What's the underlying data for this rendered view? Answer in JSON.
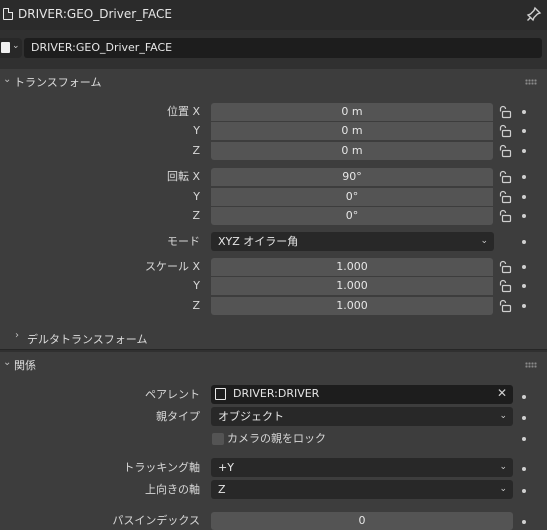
{
  "header": {
    "title": "DRIVER:GEO_Driver_FACE"
  },
  "object": {
    "name": "DRIVER:GEO_Driver_FACE"
  },
  "transform": {
    "title": "トランスフォーム",
    "location": {
      "label_x": "位置 X",
      "label_y": "Y",
      "label_z": "Z",
      "x": "0 m",
      "y": "0 m",
      "z": "0 m"
    },
    "rotation": {
      "label_x": "回転 X",
      "label_y": "Y",
      "label_z": "Z",
      "x": "90°",
      "y": "0°",
      "z": "0°"
    },
    "mode": {
      "label": "モード",
      "value": "XYZ オイラー角"
    },
    "scale": {
      "label_x": "スケール X",
      "label_y": "Y",
      "label_z": "Z",
      "x": "1.000",
      "y": "1.000",
      "z": "1.000"
    },
    "delta": {
      "title": "デルタトランスフォーム"
    }
  },
  "relations": {
    "title": "関係",
    "parent": {
      "label": "ペアレント",
      "value": "DRIVER:DRIVER"
    },
    "parent_type": {
      "label": "親タイプ",
      "value": "オブジェクト"
    },
    "camera_parent_lock": {
      "label": "カメラの親をロック",
      "checked": false
    },
    "tracking_axis": {
      "label": "トラッキング軸",
      "value": "+Y"
    },
    "up_axis": {
      "label": "上向きの軸",
      "value": "Z"
    },
    "pass_index": {
      "label": "パスインデックス",
      "value": "0"
    }
  },
  "colors": {
    "panel_bg": "#3d3d3d",
    "field_bg": "#545454",
    "dropdown_bg": "#282828",
    "window_bg": "#303030"
  }
}
